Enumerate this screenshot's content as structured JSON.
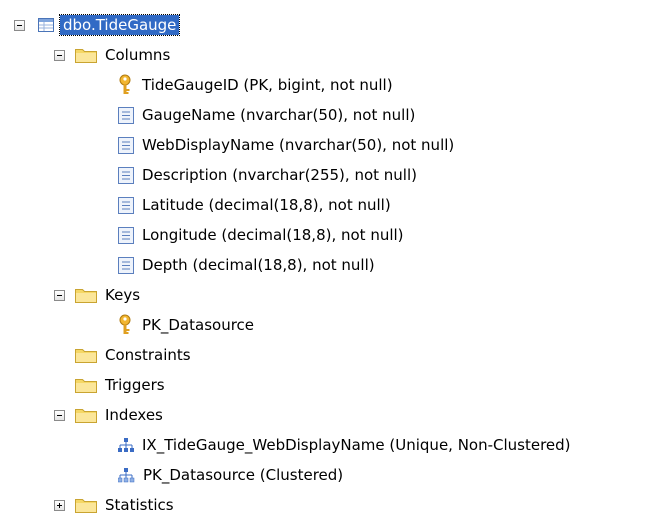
{
  "tree": {
    "table": {
      "label": "dbo.TideGauge"
    },
    "columns_folder": {
      "label": "Columns"
    },
    "columns": [
      {
        "label": "TideGaugeID (PK, bigint, not null)"
      },
      {
        "label": "GaugeName (nvarchar(50), not null)"
      },
      {
        "label": "WebDisplayName (nvarchar(50), not null)"
      },
      {
        "label": "Description (nvarchar(255), not null)"
      },
      {
        "label": "Latitude (decimal(18,8), not null)"
      },
      {
        "label": "Longitude (decimal(18,8), not null)"
      },
      {
        "label": "Depth (decimal(18,8), not null)"
      }
    ],
    "keys_folder": {
      "label": "Keys"
    },
    "keys": [
      {
        "label": "PK_Datasource"
      }
    ],
    "constraints_folder": {
      "label": "Constraints"
    },
    "triggers_folder": {
      "label": "Triggers"
    },
    "indexes_folder": {
      "label": "Indexes"
    },
    "indexes": [
      {
        "label": "IX_TideGauge_WebDisplayName (Unique, Non-Clustered)"
      },
      {
        "label": "PK_Datasource (Clustered)"
      }
    ],
    "statistics_folder": {
      "label": "Statistics"
    }
  },
  "colors": {
    "selection": "#316ac5",
    "folder": "#f5d766"
  }
}
